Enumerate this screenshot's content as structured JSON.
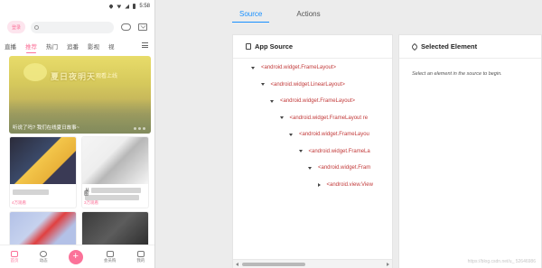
{
  "phone": {
    "status_time": "5:58",
    "login_label": "登录",
    "tabs": [
      "直播",
      "推荐",
      "热门",
      "追番",
      "影视",
      "视"
    ],
    "banner": {
      "title": "夏日夜明天",
      "title_right": "观看上线",
      "caption": "听说了吗? 我们在线夏日故事~"
    },
    "cards": [
      {
        "meta": "",
        "text": ""
      },
      {
        "meta": "",
        "text": "从"
      },
      {
        "meta": "4万观看",
        "text": "图"
      },
      {
        "meta": "3万观看",
        "text": ""
      }
    ],
    "nav": [
      "首页",
      "动态",
      "+",
      "会员购",
      "我的"
    ],
    "accent": "#fb7299"
  },
  "inspector": {
    "tabs": [
      "Source",
      "Actions"
    ],
    "active_tab": "Source",
    "source_title": "App Source",
    "selected_title": "Selected Element",
    "select_hint": "Select an element in the source to begin.",
    "tree": [
      {
        "label": "<android.widget.FrameLayout>",
        "depth": 0,
        "open": true
      },
      {
        "label": "<android.widget.LinearLayout>",
        "depth": 1,
        "open": true
      },
      {
        "label": "<android.widget.FrameLayout>",
        "depth": 2,
        "open": true
      },
      {
        "label": "<android.widget.FrameLayout re",
        "depth": 3,
        "open": true
      },
      {
        "label": "<android.widget.FrameLayou",
        "depth": 4,
        "open": true
      },
      {
        "label": "<android.widget.FrameLa",
        "depth": 5,
        "open": true
      },
      {
        "label": "<android.widget.Fram",
        "depth": 6,
        "open": true
      },
      {
        "label": "<android.view.View",
        "depth": 7,
        "open": false
      }
    ],
    "accent": "#1890ff",
    "watermark": "https://blog.csdn.net/u_ 52646986"
  }
}
